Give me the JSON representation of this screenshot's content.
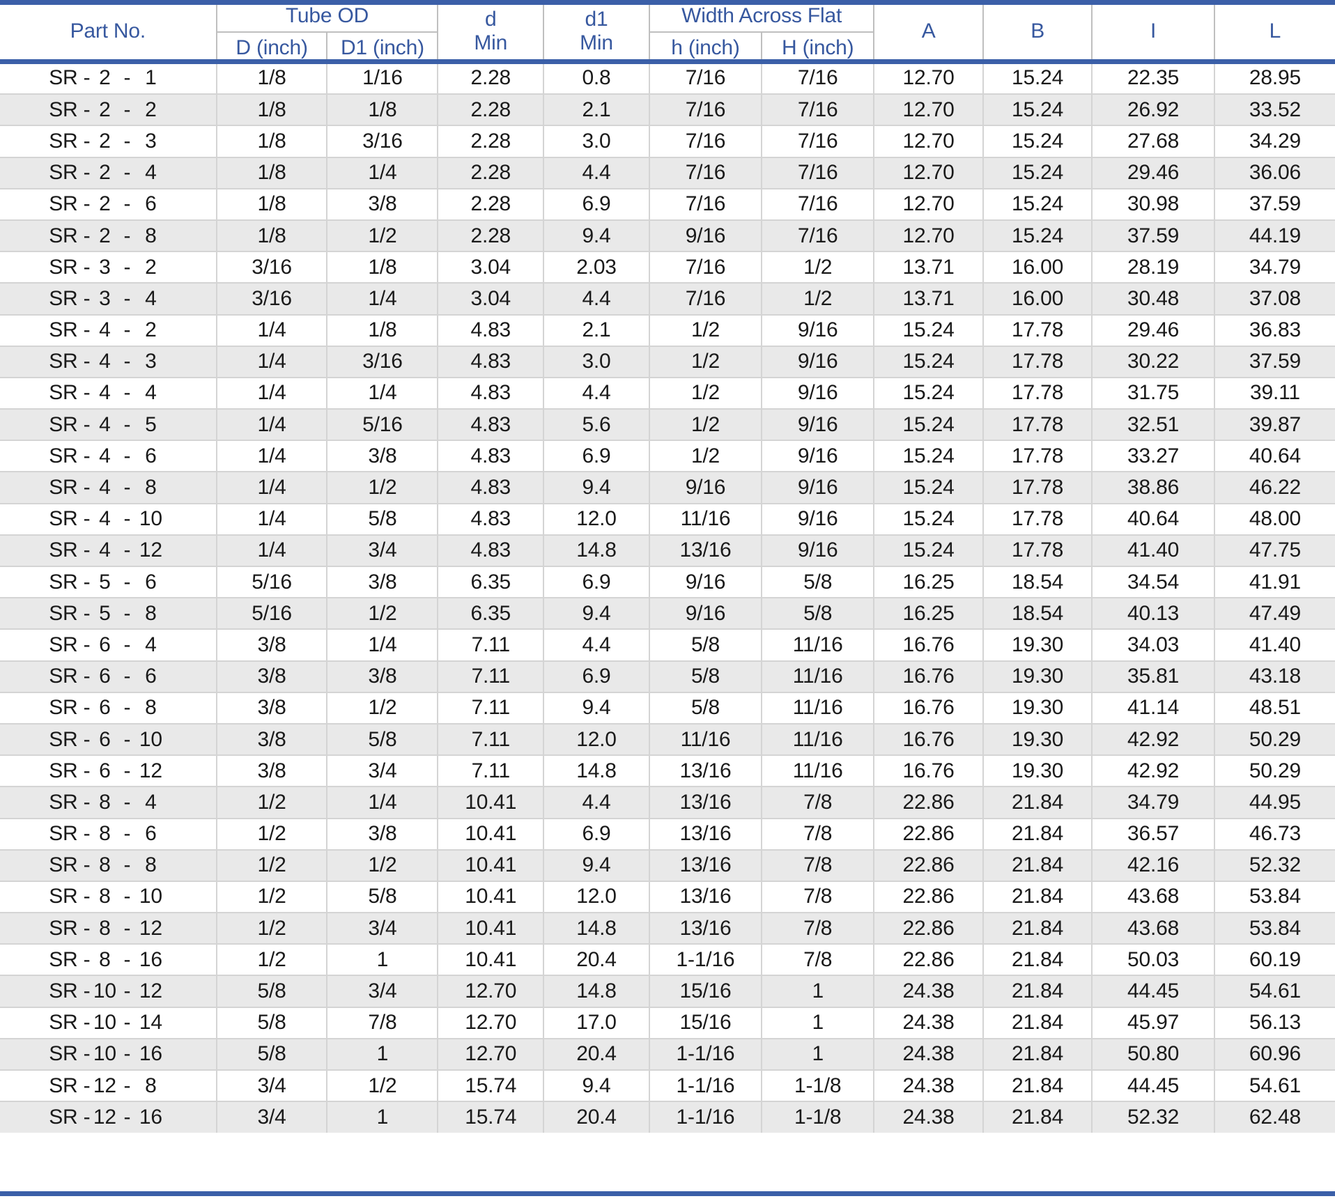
{
  "table": {
    "header": {
      "part_no": "Part No.",
      "tube_od": "Tube OD",
      "tube_od_d": "D (inch)",
      "tube_od_d1": "D1 (inch)",
      "d": "d",
      "d_min": "Min",
      "d1": "d1",
      "d1_min": "Min",
      "width_across_flat": "Width Across Flat",
      "waf_h_lower": "h (inch)",
      "waf_h_upper": "H (inch)",
      "a": "A",
      "b": "B",
      "i": "I",
      "l": "L"
    },
    "colors": {
      "header_text": "#37589f",
      "rule": "#3b5fa8",
      "grid": "#d4d4d4",
      "stripe": "#e9e9e9",
      "body_text": "#1a1a1a"
    },
    "columns": [
      "Part No.",
      "D (inch)",
      "D1 (inch)",
      "d Min",
      "d1 Min",
      "h (inch)",
      "H (inch)",
      "A",
      "B",
      "I",
      "L"
    ],
    "rows": [
      {
        "part_prefix": "SR -",
        "size1": "2",
        "size2": "1",
        "D": "1/8",
        "D1": "1/16",
        "d": "2.28",
        "d1": "0.8",
        "h": "7/16",
        "H": "7/16",
        "A": "12.70",
        "B": "15.24",
        "I": "22.35",
        "L": "28.95"
      },
      {
        "part_prefix": "SR -",
        "size1": "2",
        "size2": "2",
        "D": "1/8",
        "D1": "1/8",
        "d": "2.28",
        "d1": "2.1",
        "h": "7/16",
        "H": "7/16",
        "A": "12.70",
        "B": "15.24",
        "I": "26.92",
        "L": "33.52"
      },
      {
        "part_prefix": "SR -",
        "size1": "2",
        "size2": "3",
        "D": "1/8",
        "D1": "3/16",
        "d": "2.28",
        "d1": "3.0",
        "h": "7/16",
        "H": "7/16",
        "A": "12.70",
        "B": "15.24",
        "I": "27.68",
        "L": "34.29"
      },
      {
        "part_prefix": "SR -",
        "size1": "2",
        "size2": "4",
        "D": "1/8",
        "D1": "1/4",
        "d": "2.28",
        "d1": "4.4",
        "h": "7/16",
        "H": "7/16",
        "A": "12.70",
        "B": "15.24",
        "I": "29.46",
        "L": "36.06"
      },
      {
        "part_prefix": "SR -",
        "size1": "2",
        "size2": "6",
        "D": "1/8",
        "D1": "3/8",
        "d": "2.28",
        "d1": "6.9",
        "h": "7/16",
        "H": "7/16",
        "A": "12.70",
        "B": "15.24",
        "I": "30.98",
        "L": "37.59"
      },
      {
        "part_prefix": "SR -",
        "size1": "2",
        "size2": "8",
        "D": "1/8",
        "D1": "1/2",
        "d": "2.28",
        "d1": "9.4",
        "h": "9/16",
        "H": "7/16",
        "A": "12.70",
        "B": "15.24",
        "I": "37.59",
        "L": "44.19"
      },
      {
        "part_prefix": "SR -",
        "size1": "3",
        "size2": "2",
        "D": "3/16",
        "D1": "1/8",
        "d": "3.04",
        "d1": "2.03",
        "h": "7/16",
        "H": "1/2",
        "A": "13.71",
        "B": "16.00",
        "I": "28.19",
        "L": "34.79"
      },
      {
        "part_prefix": "SR -",
        "size1": "3",
        "size2": "4",
        "D": "3/16",
        "D1": "1/4",
        "d": "3.04",
        "d1": "4.4",
        "h": "7/16",
        "H": "1/2",
        "A": "13.71",
        "B": "16.00",
        "I": "30.48",
        "L": "37.08"
      },
      {
        "part_prefix": "SR -",
        "size1": "4",
        "size2": "2",
        "D": "1/4",
        "D1": "1/8",
        "d": "4.83",
        "d1": "2.1",
        "h": "1/2",
        "H": "9/16",
        "A": "15.24",
        "B": "17.78",
        "I": "29.46",
        "L": "36.83"
      },
      {
        "part_prefix": "SR -",
        "size1": "4",
        "size2": "3",
        "D": "1/4",
        "D1": "3/16",
        "d": "4.83",
        "d1": "3.0",
        "h": "1/2",
        "H": "9/16",
        "A": "15.24",
        "B": "17.78",
        "I": "30.22",
        "L": "37.59"
      },
      {
        "part_prefix": "SR -",
        "size1": "4",
        "size2": "4",
        "D": "1/4",
        "D1": "1/4",
        "d": "4.83",
        "d1": "4.4",
        "h": "1/2",
        "H": "9/16",
        "A": "15.24",
        "B": "17.78",
        "I": "31.75",
        "L": "39.11"
      },
      {
        "part_prefix": "SR -",
        "size1": "4",
        "size2": "5",
        "D": "1/4",
        "D1": "5/16",
        "d": "4.83",
        "d1": "5.6",
        "h": "1/2",
        "H": "9/16",
        "A": "15.24",
        "B": "17.78",
        "I": "32.51",
        "L": "39.87"
      },
      {
        "part_prefix": "SR -",
        "size1": "4",
        "size2": "6",
        "D": "1/4",
        "D1": "3/8",
        "d": "4.83",
        "d1": "6.9",
        "h": "1/2",
        "H": "9/16",
        "A": "15.24",
        "B": "17.78",
        "I": "33.27",
        "L": "40.64"
      },
      {
        "part_prefix": "SR -",
        "size1": "4",
        "size2": "8",
        "D": "1/4",
        "D1": "1/2",
        "d": "4.83",
        "d1": "9.4",
        "h": "9/16",
        "H": "9/16",
        "A": "15.24",
        "B": "17.78",
        "I": "38.86",
        "L": "46.22"
      },
      {
        "part_prefix": "SR -",
        "size1": "4",
        "size2": "10",
        "D": "1/4",
        "D1": "5/8",
        "d": "4.83",
        "d1": "12.0",
        "h": "11/16",
        "H": "9/16",
        "A": "15.24",
        "B": "17.78",
        "I": "40.64",
        "L": "48.00"
      },
      {
        "part_prefix": "SR -",
        "size1": "4",
        "size2": "12",
        "D": "1/4",
        "D1": "3/4",
        "d": "4.83",
        "d1": "14.8",
        "h": "13/16",
        "H": "9/16",
        "A": "15.24",
        "B": "17.78",
        "I": "41.40",
        "L": "47.75"
      },
      {
        "part_prefix": "SR -",
        "size1": "5",
        "size2": "6",
        "D": "5/16",
        "D1": "3/8",
        "d": "6.35",
        "d1": "6.9",
        "h": "9/16",
        "H": "5/8",
        "A": "16.25",
        "B": "18.54",
        "I": "34.54",
        "L": "41.91"
      },
      {
        "part_prefix": "SR -",
        "size1": "5",
        "size2": "8",
        "D": "5/16",
        "D1": "1/2",
        "d": "6.35",
        "d1": "9.4",
        "h": "9/16",
        "H": "5/8",
        "A": "16.25",
        "B": "18.54",
        "I": "40.13",
        "L": "47.49"
      },
      {
        "part_prefix": "SR -",
        "size1": "6",
        "size2": "4",
        "D": "3/8",
        "D1": "1/4",
        "d": "7.11",
        "d1": "4.4",
        "h": "5/8",
        "H": "11/16",
        "A": "16.76",
        "B": "19.30",
        "I": "34.03",
        "L": "41.40"
      },
      {
        "part_prefix": "SR -",
        "size1": "6",
        "size2": "6",
        "D": "3/8",
        "D1": "3/8",
        "d": "7.11",
        "d1": "6.9",
        "h": "5/8",
        "H": "11/16",
        "A": "16.76",
        "B": "19.30",
        "I": "35.81",
        "L": "43.18"
      },
      {
        "part_prefix": "SR -",
        "size1": "6",
        "size2": "8",
        "D": "3/8",
        "D1": "1/2",
        "d": "7.11",
        "d1": "9.4",
        "h": "5/8",
        "H": "11/16",
        "A": "16.76",
        "B": "19.30",
        "I": "41.14",
        "L": "48.51"
      },
      {
        "part_prefix": "SR -",
        "size1": "6",
        "size2": "10",
        "D": "3/8",
        "D1": "5/8",
        "d": "7.11",
        "d1": "12.0",
        "h": "11/16",
        "H": "11/16",
        "A": "16.76",
        "B": "19.30",
        "I": "42.92",
        "L": "50.29"
      },
      {
        "part_prefix": "SR -",
        "size1": "6",
        "size2": "12",
        "D": "3/8",
        "D1": "3/4",
        "d": "7.11",
        "d1": "14.8",
        "h": "13/16",
        "H": "11/16",
        "A": "16.76",
        "B": "19.30",
        "I": "42.92",
        "L": "50.29"
      },
      {
        "part_prefix": "SR -",
        "size1": "8",
        "size2": "4",
        "D": "1/2",
        "D1": "1/4",
        "d": "10.41",
        "d1": "4.4",
        "h": "13/16",
        "H": "7/8",
        "A": "22.86",
        "B": "21.84",
        "I": "34.79",
        "L": "44.95"
      },
      {
        "part_prefix": "SR -",
        "size1": "8",
        "size2": "6",
        "D": "1/2",
        "D1": "3/8",
        "d": "10.41",
        "d1": "6.9",
        "h": "13/16",
        "H": "7/8",
        "A": "22.86",
        "B": "21.84",
        "I": "36.57",
        "L": "46.73"
      },
      {
        "part_prefix": "SR -",
        "size1": "8",
        "size2": "8",
        "D": "1/2",
        "D1": "1/2",
        "d": "10.41",
        "d1": "9.4",
        "h": "13/16",
        "H": "7/8",
        "A": "22.86",
        "B": "21.84",
        "I": "42.16",
        "L": "52.32"
      },
      {
        "part_prefix": "SR -",
        "size1": "8",
        "size2": "10",
        "D": "1/2",
        "D1": "5/8",
        "d": "10.41",
        "d1": "12.0",
        "h": "13/16",
        "H": "7/8",
        "A": "22.86",
        "B": "21.84",
        "I": "43.68",
        "L": "53.84"
      },
      {
        "part_prefix": "SR -",
        "size1": "8",
        "size2": "12",
        "D": "1/2",
        "D1": "3/4",
        "d": "10.41",
        "d1": "14.8",
        "h": "13/16",
        "H": "7/8",
        "A": "22.86",
        "B": "21.84",
        "I": "43.68",
        "L": "53.84"
      },
      {
        "part_prefix": "SR -",
        "size1": "8",
        "size2": "16",
        "D": "1/2",
        "D1": "1",
        "d": "10.41",
        "d1": "20.4",
        "h": "1-1/16",
        "H": "7/8",
        "A": "22.86",
        "B": "21.84",
        "I": "50.03",
        "L": "60.19"
      },
      {
        "part_prefix": "SR -",
        "size1": "10",
        "size2": "12",
        "D": "5/8",
        "D1": "3/4",
        "d": "12.70",
        "d1": "14.8",
        "h": "15/16",
        "H": "1",
        "A": "24.38",
        "B": "21.84",
        "I": "44.45",
        "L": "54.61"
      },
      {
        "part_prefix": "SR -",
        "size1": "10",
        "size2": "14",
        "D": "5/8",
        "D1": "7/8",
        "d": "12.70",
        "d1": "17.0",
        "h": "15/16",
        "H": "1",
        "A": "24.38",
        "B": "21.84",
        "I": "45.97",
        "L": "56.13"
      },
      {
        "part_prefix": "SR -",
        "size1": "10",
        "size2": "16",
        "D": "5/8",
        "D1": "1",
        "d": "12.70",
        "d1": "20.4",
        "h": "1-1/16",
        "H": "1",
        "A": "24.38",
        "B": "21.84",
        "I": "50.80",
        "L": "60.96"
      },
      {
        "part_prefix": "SR -",
        "size1": "12",
        "size2": "8",
        "D": "3/4",
        "D1": "1/2",
        "d": "15.74",
        "d1": "9.4",
        "h": "1-1/16",
        "H": "1-1/8",
        "A": "24.38",
        "B": "21.84",
        "I": "44.45",
        "L": "54.61"
      },
      {
        "part_prefix": "SR -",
        "size1": "12",
        "size2": "16",
        "D": "3/4",
        "D1": "1",
        "d": "15.74",
        "d1": "20.4",
        "h": "1-1/16",
        "H": "1-1/8",
        "A": "24.38",
        "B": "21.84",
        "I": "52.32",
        "L": "62.48"
      }
    ]
  }
}
